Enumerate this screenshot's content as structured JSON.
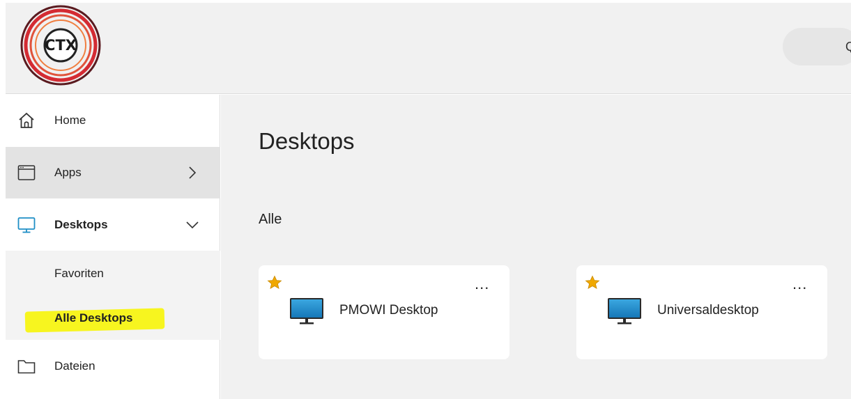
{
  "header": {
    "logo_text": "CTX",
    "search_hint": "Q"
  },
  "sidebar": {
    "items": [
      {
        "label": "Home",
        "icon": "home-icon"
      },
      {
        "label": "Apps",
        "icon": "apps-icon"
      },
      {
        "label": "Desktops",
        "icon": "desktop-icon"
      },
      {
        "label": "Dateien",
        "icon": "folder-icon"
      }
    ],
    "subitems": [
      {
        "label": "Favoriten"
      },
      {
        "label": "Alle Desktops",
        "highlight_color": "#f7f51f"
      }
    ]
  },
  "main": {
    "title": "Desktops",
    "section": "Alle",
    "cards": [
      {
        "name": "PMOWI Desktop",
        "more": "..."
      },
      {
        "name": "Universaldesktop",
        "more": "..."
      }
    ]
  },
  "colors": {
    "accent": "#1f8fc6",
    "star": "#f0a800",
    "logo_ring": "#e03a3e",
    "highlight": "#f7f51f"
  }
}
